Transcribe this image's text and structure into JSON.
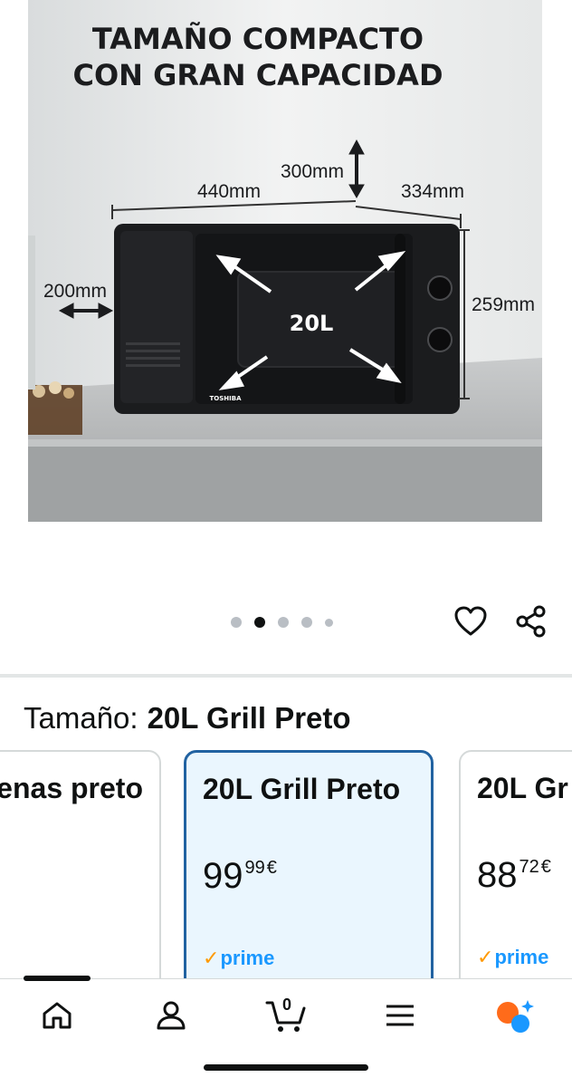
{
  "image": {
    "headline_line1": "TAMAÑO COMPACTO",
    "headline_line2": "CON GRAN CAPACIDAD",
    "dim_width": "440mm",
    "dim_height_top": "300mm",
    "dim_depth": "334mm",
    "dim_side": "200mm",
    "dim_height": "259mm",
    "capacity": "20L",
    "brand": "TOSHIBA"
  },
  "carousel": {
    "dots": [
      "dot",
      "dot-active",
      "dot",
      "dot",
      "dot-small"
    ],
    "active_index": 1,
    "favorite_icon": "heart-icon",
    "share_icon": "share-icon"
  },
  "size_selector": {
    "label": "Tamaño:",
    "selected_value": "20L Grill Preto",
    "variants": [
      {
        "name": "enas preto",
        "price_whole": "",
        "price_fraction": "",
        "currency": "",
        "prime": false
      },
      {
        "name": "20L Grill Preto",
        "price_whole": "99",
        "price_fraction": "99",
        "currency": "€",
        "prime": true,
        "selected": true
      },
      {
        "name": "20L Gr",
        "price_whole": "88",
        "price_fraction": "72",
        "currency": "€",
        "prime": true
      }
    ],
    "prime_label": "prime"
  },
  "bottom_nav": {
    "items": [
      "home-icon",
      "account-icon",
      "cart-icon",
      "menu-icon",
      "rufus-icon"
    ],
    "cart_count": "0"
  },
  "colors": {
    "selected_border": "#2162a1",
    "selected_bg": "#eaf6fe",
    "prime_blue": "#1a98ff",
    "prime_check": "#ff9900",
    "rufus_orange": "#ff6b1a",
    "rufus_blue": "#1a98ff"
  }
}
